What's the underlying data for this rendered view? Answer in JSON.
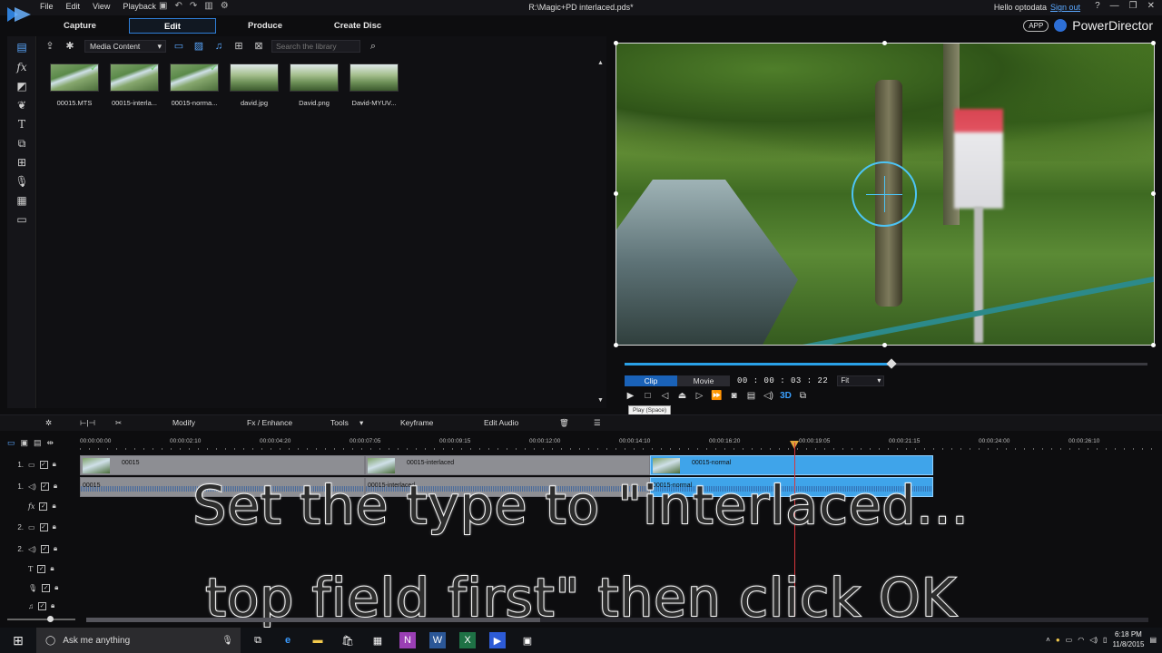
{
  "app": {
    "menu": [
      "File",
      "Edit",
      "View",
      "Playback"
    ],
    "doc_title": "R:\\Magic+PD interlaced.pds*",
    "user_greeting": "Hello optodata",
    "sign_out": "Sign out",
    "brand": "PowerDirector",
    "app_pill": "APP",
    "window_controls": [
      "?",
      "—",
      "❐",
      "✕"
    ]
  },
  "modes": [
    "Capture",
    "Edit",
    "Produce",
    "Create Disc"
  ],
  "active_mode": "Edit",
  "library": {
    "dropdown_value": "Media Content",
    "search_placeholder": "Search the library",
    "items": [
      {
        "name": "00015.MTS",
        "used": true
      },
      {
        "name": "00015-interla...",
        "used": true
      },
      {
        "name": "00015-norma...",
        "used": true
      },
      {
        "name": "david.jpg",
        "used": false
      },
      {
        "name": "David.png",
        "used": false
      },
      {
        "name": "David-MYUV...",
        "used": false
      }
    ]
  },
  "preview": {
    "clip_label": "Clip",
    "movie_label": "Movie",
    "timecode": "00 : 00 : 03 : 22",
    "fit_label": "Fit",
    "progress": 0.51,
    "tooltip": "Play (Space)",
    "transport_icons": [
      "play-icon",
      "stop-icon",
      "previous-frame-icon",
      "split-icon",
      "next-frame-icon",
      "fast-forward-icon",
      "snapshot-icon",
      "subtitle-icon",
      "volume-icon",
      "3d-icon",
      "undock-icon"
    ]
  },
  "timeline_toolbar": {
    "modify": "Modify",
    "fx": "Fx / Enhance",
    "tools": "Tools",
    "keyframe": "Keyframe",
    "edit_audio": "Edit Audio"
  },
  "ruler": [
    "00:00:00:00",
    "00:00:02:10",
    "00:00:04:20",
    "00:00:07:05",
    "00:00:09:15",
    "00:00:12:00",
    "00:00:14:10",
    "00:00:16:20",
    "00:00:19:05",
    "00:00:21:15",
    "00:00:24:00",
    "00:00:26:10"
  ],
  "tracks": [
    {
      "num": "1.",
      "kind": "video-icon"
    },
    {
      "num": "1.",
      "kind": "audio-icon"
    },
    {
      "num": "",
      "kind": "fx-icon"
    },
    {
      "num": "2.",
      "kind": "video-icon"
    },
    {
      "num": "2.",
      "kind": "audio-icon"
    },
    {
      "num": "",
      "kind": "title-icon"
    },
    {
      "num": "",
      "kind": "voice-icon"
    },
    {
      "num": "",
      "kind": "music-icon"
    }
  ],
  "clips": {
    "video": [
      "00015",
      "00015-interlaced",
      "00015-normal"
    ],
    "audio": [
      "00015",
      "00015-interlaced",
      "00015-normal"
    ]
  },
  "caption": {
    "line1": "Set the type to \"interlaced...",
    "line2": "top field first\" then click OK"
  },
  "taskbar": {
    "search": "Ask me anything",
    "time": "6:18 PM",
    "date": "11/8/2015"
  }
}
